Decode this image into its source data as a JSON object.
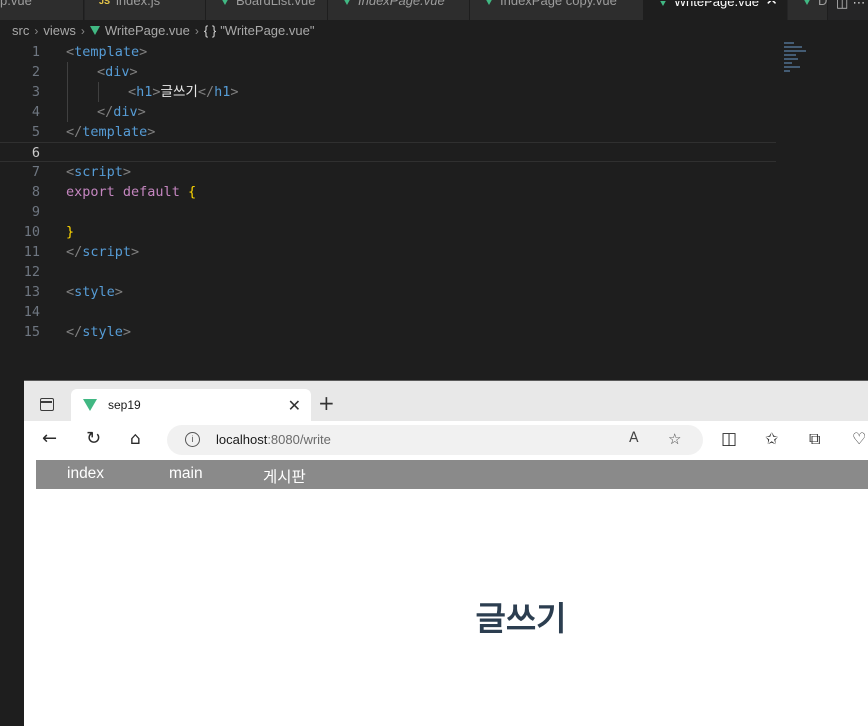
{
  "editor": {
    "tabs": [
      {
        "label": "p.vue",
        "icon": "vue-icon",
        "italic": false,
        "active": false
      },
      {
        "label": "index.js",
        "icon": "js-icon",
        "italic": false,
        "active": false
      },
      {
        "label": "BoardList.vue",
        "icon": "vue-icon",
        "italic": false,
        "active": false
      },
      {
        "label": "IndexPage.vue",
        "icon": "vue-icon",
        "italic": true,
        "active": false
      },
      {
        "label": "IndexPage copy.vue",
        "icon": "vue-icon",
        "italic": false,
        "active": false
      },
      {
        "label": "WritePage.vue",
        "icon": "vue-icon",
        "italic": false,
        "active": true
      },
      {
        "label": "D",
        "icon": "vue-icon",
        "italic": false,
        "active": false
      }
    ],
    "js_badge": "JS",
    "breadcrumb": {
      "folder1": "src",
      "folder2": "views",
      "file": "WritePage.vue",
      "braces": "{ }",
      "symbol": "\"WritePage.vue\""
    },
    "current_line": 6,
    "line_numbers": [
      "1",
      "2",
      "3",
      "4",
      "5",
      "6",
      "7",
      "8",
      "9",
      "10",
      "11",
      "12",
      "13",
      "14",
      "15"
    ],
    "code": [
      [
        "<",
        "template",
        ">"
      ],
      [
        "<",
        "div",
        ">"
      ],
      [
        "<",
        "h1",
        ">",
        "글쓰기",
        "</",
        "h1",
        ">"
      ],
      [
        "</",
        "div",
        ">"
      ],
      [
        "</",
        "template",
        ">"
      ],
      [],
      [
        "<",
        "script",
        ">"
      ],
      [
        "export",
        "default",
        "{"
      ],
      [],
      [
        "}"
      ],
      [
        "</",
        "script",
        ">"
      ],
      [],
      [
        "<",
        "style",
        ">"
      ],
      [],
      [
        "</",
        "style",
        ">"
      ]
    ]
  },
  "browser": {
    "tab_title": "sep19",
    "url_host": "localhost",
    "url_rest": ":8080/write",
    "nav": [
      "index",
      "main",
      "게시판"
    ],
    "heading": "글쓰기"
  },
  "colors": {
    "vue_green": "#41b883",
    "navbar_bg": "#8a8a8a",
    "heading": "#2c3e50"
  }
}
